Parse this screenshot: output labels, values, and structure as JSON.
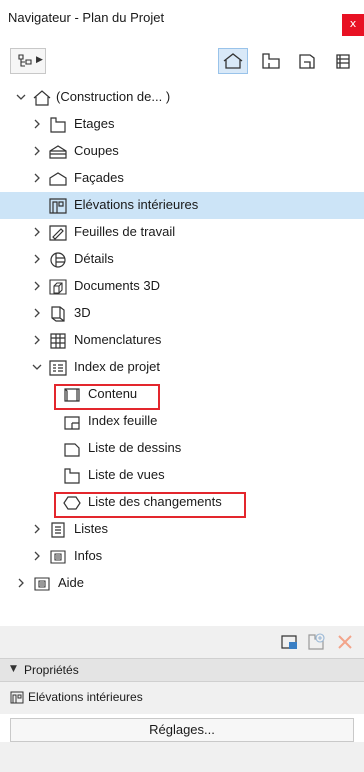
{
  "window": {
    "title": "Navigateur - Plan du Projet",
    "close_label": "x"
  },
  "toolbar": {
    "left_button_icon": "tree-structure-icon",
    "modes": [
      {
        "icon": "house-icon",
        "active": true
      },
      {
        "icon": "floor-plan-icon",
        "active": false
      },
      {
        "icon": "layout-book-icon",
        "active": false
      },
      {
        "icon": "publisher-sets-icon",
        "active": false
      }
    ]
  },
  "tree": {
    "items": [
      {
        "label": "(Construction de... )",
        "level": 0,
        "chevron": "down",
        "icon": "house-icon"
      },
      {
        "label": "Etages",
        "level": 1,
        "chevron": "right",
        "icon": "floor-icon"
      },
      {
        "label": "Coupes",
        "level": 1,
        "chevron": "right",
        "icon": "section-icon"
      },
      {
        "label": "Façades",
        "level": 1,
        "chevron": "right",
        "icon": "facade-icon"
      },
      {
        "label": "Elévations intérieures",
        "level": 1,
        "chevron": "none",
        "icon": "interior-elevation-icon",
        "selected": true
      },
      {
        "label": "Feuilles de travail",
        "level": 1,
        "chevron": "right",
        "icon": "worksheet-icon"
      },
      {
        "label": "Détails",
        "level": 1,
        "chevron": "right",
        "icon": "detail-icon"
      },
      {
        "label": "Documents 3D",
        "level": 1,
        "chevron": "right",
        "icon": "document-3d-icon"
      },
      {
        "label": "3D",
        "level": 1,
        "chevron": "right",
        "icon": "cube-3d-icon"
      },
      {
        "label": "Nomenclatures",
        "level": 1,
        "chevron": "right",
        "icon": "schedule-icon"
      },
      {
        "label": "Index de projet",
        "level": 1,
        "chevron": "down",
        "icon": "project-index-icon"
      },
      {
        "label": "Contenu",
        "level": 2,
        "chevron": "none",
        "icon": "contents-icon",
        "highlighted": true
      },
      {
        "label": "Index feuille",
        "level": 2,
        "chevron": "none",
        "icon": "sheet-index-icon"
      },
      {
        "label": "Liste de dessins",
        "level": 2,
        "chevron": "none",
        "icon": "drawing-list-icon"
      },
      {
        "label": "Liste de vues",
        "level": 2,
        "chevron": "none",
        "icon": "view-list-icon"
      },
      {
        "label": "Liste des changements",
        "level": 2,
        "chevron": "none",
        "icon": "change-list-icon",
        "highlighted": true
      },
      {
        "label": "Listes",
        "level": 1,
        "chevron": "right",
        "icon": "lists-icon"
      },
      {
        "label": "Infos",
        "level": 1,
        "chevron": "right",
        "icon": "info-icon"
      },
      {
        "label": "Aide",
        "level": 0,
        "chevron": "right",
        "icon": "help-icon"
      }
    ]
  },
  "bottom_tools": [
    {
      "icon": "new-layout-icon",
      "enabled": true
    },
    {
      "icon": "new-view-icon",
      "enabled": false
    },
    {
      "icon": "delete-icon",
      "enabled": false
    }
  ],
  "properties": {
    "header": "Propriétés",
    "item_label": "Elévations intérieures",
    "item_icon": "interior-elevation-icon",
    "settings_button": "Réglages..."
  },
  "colors": {
    "selection": "#cce4f7",
    "highlight_border": "#e3262d",
    "close_button": "#e81123",
    "active_mode": "#d9e9f8"
  }
}
